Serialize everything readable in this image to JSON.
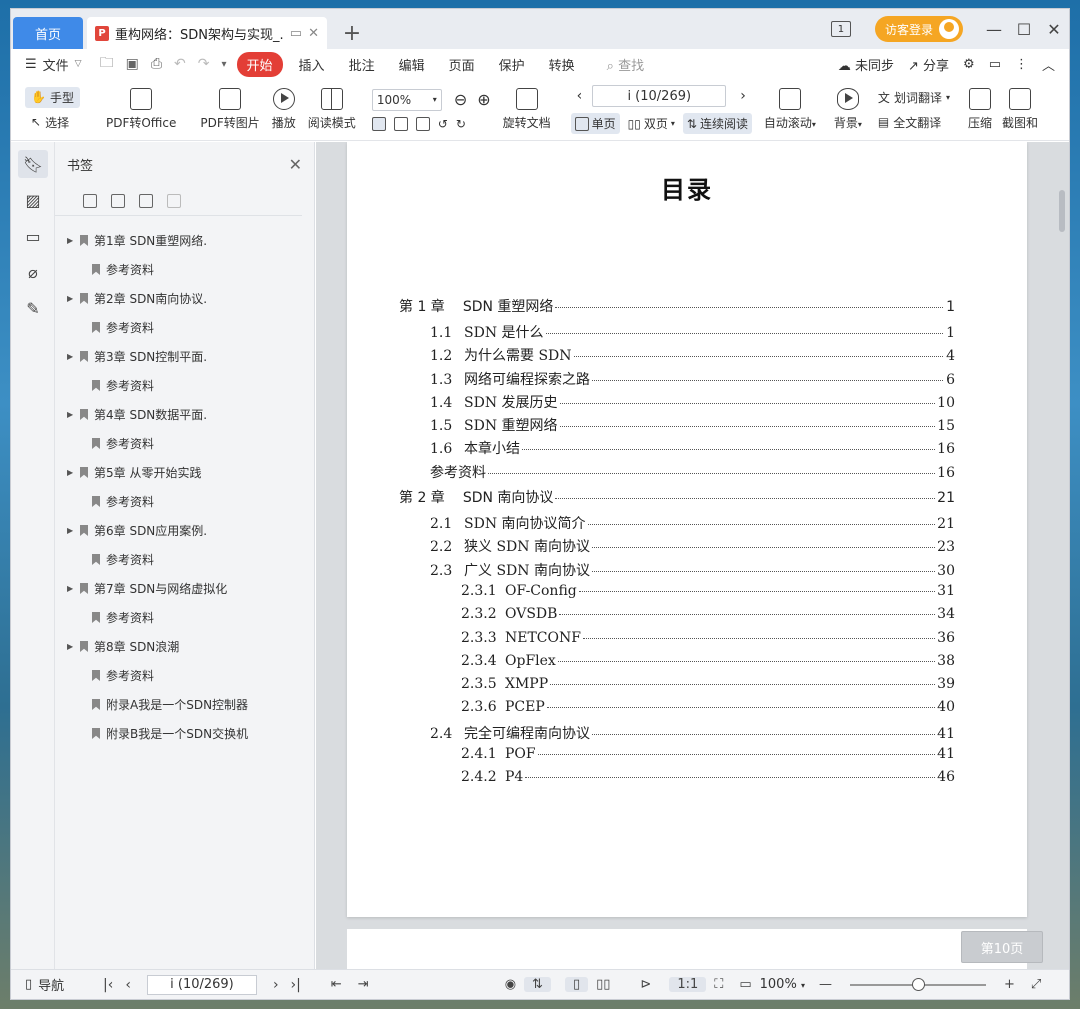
{
  "titlebar": {
    "home_tab": "首页",
    "doc_tab": "重构网络：SDN架构与实现_.pdf",
    "page_indicator": "1",
    "login_label": "访客登录"
  },
  "menubar": {
    "file": "文件",
    "start": "开始",
    "items": [
      "插入",
      "批注",
      "编辑",
      "页面",
      "保护",
      "转换"
    ],
    "search_placeholder": "查找",
    "unsynced": "未同步",
    "share": "分享"
  },
  "ribbon": {
    "hand": "手型",
    "select": "选择",
    "pdf_to_office": "PDF转Office",
    "pdf_to_image": "PDF转图片",
    "play": "播放",
    "read_mode": "阅读模式",
    "zoom": "100%",
    "page": "i (10/269)",
    "rotate": "旋转文档",
    "single": "单页",
    "double": "双页",
    "continuous": "连续阅读",
    "autoscroll": "自动滚动",
    "background": "背景",
    "word_translate": "划词翻译",
    "full_translate": "全文翻译",
    "compress": "压缩",
    "screenshot": "截图和"
  },
  "bookmarks": {
    "title": "书签",
    "items": [
      {
        "label": "第1章 SDN重塑网络.",
        "expandable": true
      },
      {
        "label": "参考资料",
        "expandable": false
      },
      {
        "label": "第2章 SDN南向协议.",
        "expandable": true
      },
      {
        "label": "参考资料",
        "expandable": false
      },
      {
        "label": "第3章 SDN控制平面.",
        "expandable": true
      },
      {
        "label": "参考资料",
        "expandable": false
      },
      {
        "label": "第4章 SDN数据平面.",
        "expandable": true
      },
      {
        "label": "参考资料",
        "expandable": false
      },
      {
        "label": "第5章 从零开始实践",
        "expandable": true
      },
      {
        "label": "参考资料",
        "expandable": false
      },
      {
        "label": "第6章 SDN应用案例.",
        "expandable": true
      },
      {
        "label": "参考资料",
        "expandable": false
      },
      {
        "label": "第7章 SDN与网络虚拟化",
        "expandable": true
      },
      {
        "label": "参考资料",
        "expandable": false
      },
      {
        "label": "第8章 SDN浪潮",
        "expandable": true
      },
      {
        "label": "参考资料",
        "expandable": false
      },
      {
        "label": "附录A我是一个SDN控制器",
        "expandable": false
      },
      {
        "label": "附录B我是一个SDN交换机",
        "expandable": false
      }
    ]
  },
  "document": {
    "title": "目录",
    "toc": [
      {
        "level": 1,
        "num": "第 1 章",
        "text": "SDN 重塑网络",
        "page": "1"
      },
      {
        "level": 2,
        "num": "1.1",
        "text": "SDN 是什么",
        "page": "1"
      },
      {
        "level": 2,
        "num": "1.2",
        "text": "为什么需要 SDN",
        "page": "4"
      },
      {
        "level": 2,
        "num": "1.3",
        "text": "网络可编程探索之路",
        "page": "6"
      },
      {
        "level": 2,
        "num": "1.4",
        "text": "SDN 发展历史",
        "page": "10"
      },
      {
        "level": 2,
        "num": "1.5",
        "text": "SDN 重塑网络",
        "page": "15"
      },
      {
        "level": 2,
        "num": "1.6",
        "text": "本章小结",
        "page": "16"
      },
      {
        "level": 2,
        "num": "",
        "text": "参考资料",
        "page": "16"
      },
      {
        "level": 1,
        "num": "第 2 章",
        "text": "SDN 南向协议",
        "page": "21"
      },
      {
        "level": 2,
        "num": "2.1",
        "text": "SDN 南向协议简介",
        "page": "21"
      },
      {
        "level": 2,
        "num": "2.2",
        "text": "狭义 SDN 南向协议",
        "page": "23"
      },
      {
        "level": 2,
        "num": "2.3",
        "text": "广义 SDN 南向协议",
        "page": "30"
      },
      {
        "level": 3,
        "num": "2.3.1",
        "text": "OF-Config",
        "page": "31"
      },
      {
        "level": 3,
        "num": "2.3.2",
        "text": "OVSDB",
        "page": "34"
      },
      {
        "level": 3,
        "num": "2.3.3",
        "text": "NETCONF",
        "page": "36"
      },
      {
        "level": 3,
        "num": "2.3.4",
        "text": "OpFlex",
        "page": "38"
      },
      {
        "level": 3,
        "num": "2.3.5",
        "text": "XMPP",
        "page": "39"
      },
      {
        "level": 3,
        "num": "2.3.6",
        "text": "PCEP",
        "page": "40"
      },
      {
        "level": 2,
        "num": "2.4",
        "text": "完全可编程南向协议",
        "page": "41"
      },
      {
        "level": 3,
        "num": "2.4.1",
        "text": "POF",
        "page": "41"
      },
      {
        "level": 3,
        "num": "2.4.2",
        "text": "P4",
        "page": "46"
      }
    ],
    "page_badge": "第10页"
  },
  "statusbar": {
    "nav": "导航",
    "page": "i (10/269)",
    "zoom": "100%",
    "zoom_level": 0.5
  }
}
